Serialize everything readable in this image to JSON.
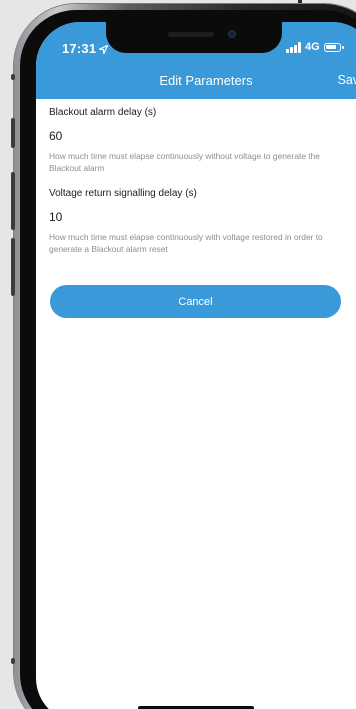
{
  "status_bar": {
    "time": "17:31",
    "location_icon": "location-arrow-icon",
    "network": "4G",
    "signal_icon": "cellular-signal-icon",
    "battery_icon": "battery-icon"
  },
  "nav": {
    "title": "Edit Parameters",
    "save_label": "Save"
  },
  "fields": [
    {
      "label": "Blackout alarm delay (s)",
      "value": "60",
      "help": "How much time must elapse continuously without voltage to generate the Blackout alarm"
    },
    {
      "label": "Voltage return signalling delay (s)",
      "value": "10",
      "help": "How much time must elapse continuously with voltage restored in order to generate a Blackout alarm reset"
    }
  ],
  "cancel_label": "Cancel",
  "colors": {
    "accent": "#3a9ad9",
    "help_text": "#8e8e8e",
    "background": "#ffffff"
  }
}
